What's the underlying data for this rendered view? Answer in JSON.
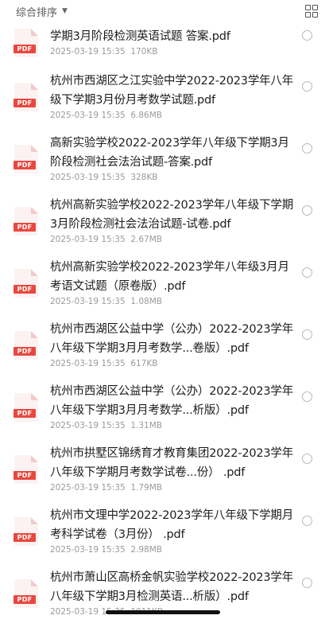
{
  "header": {
    "sort_label": "综合排序",
    "caret": "▼",
    "view_icon": "grid-view-icon"
  },
  "files": [
    {
      "title": "学期3月阶段检测英语试题 答案.pdf",
      "date": "2025-03-19 15:35",
      "size": "170KB"
    },
    {
      "title": "杭州市西湖区之江实验中学2022-2023学年八年级下学期3月份月考数学试题.pdf",
      "date": "2025-03-19 15:35",
      "size": "6.86MB"
    },
    {
      "title": "高新实验学校2022-2023学年八年级下学期3月阶段检测社会法治试题-答案.pdf",
      "date": "2025-03-19 15:35",
      "size": "328KB"
    },
    {
      "title": "杭州高新实验学校2022-2023学年八年级下学期3月阶段检测社会法治试题-试卷.pdf",
      "date": "2025-03-19 15:35",
      "size": "2.67MB"
    },
    {
      "title": "杭州高新实验学校2022-2023学年八年级3月月考语文试题（原卷版）.pdf",
      "date": "2025-03-19 15:35",
      "size": "1.08MB"
    },
    {
      "title": "杭州市西湖区公益中学（公办）2022-2023学年八年级下学期3月月考数学...卷版）.pdf",
      "date": "2025-03-19 15:35",
      "size": "617KB"
    },
    {
      "title": "杭州市西湖区公益中学（公办）2022-2023学年八年级下学期3月月考数学...析版）.pdf",
      "date": "2025-03-19 15:35",
      "size": "1.31MB"
    },
    {
      "title": "杭州市拱墅区锦绣育才教育集团2022-2023学年八年级下学期月考数学试卷...份） .pdf",
      "date": "2025-03-19 15:35",
      "size": "1.79MB"
    },
    {
      "title": "杭州市文理中学2022-2023学年八年级下学期月考科学试卷（3月份） .pdf",
      "date": "2025-03-19 15:35",
      "size": "2.98MB"
    },
    {
      "title": "杭州市萧山区高桥金帆实验学校2022-2023学年八年级下学期3月检测英语...析版）.pdf",
      "date": "2025-03-19 15:35",
      "size": "1011KB"
    }
  ],
  "pdf_badge": "PDF"
}
